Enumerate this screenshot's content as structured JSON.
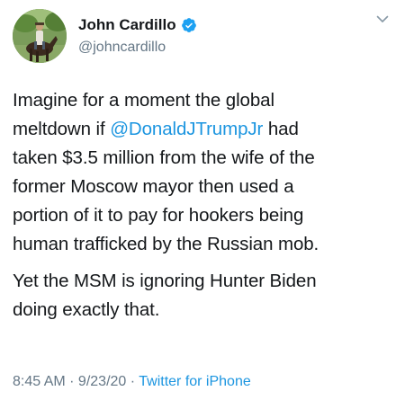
{
  "author": {
    "display_name": "John Cardillo",
    "handle": "@johncardillo",
    "verified": true,
    "avatar_icon": "avatar-photo",
    "verified_icon": "verified-badge-icon",
    "caret_icon": "chevron-down-icon"
  },
  "tweet": {
    "para1": {
      "line1": "Imagine for a moment the global",
      "line2_before": "meltdown if ",
      "line2_mention": "@DonaldJTrumpJr",
      "line2_after": " had",
      "line3": "taken $3.5 million from the wife of the",
      "line4": "former Moscow mayor then used a",
      "line5": "portion of it to pay for hookers being",
      "line6": "human trafficked by the Russian mob."
    },
    "para2": {
      "line1": "Yet the MSM is ignoring Hunter Biden",
      "line2": "doing exactly that."
    }
  },
  "meta": {
    "time": "8:45 AM",
    "sep1": " · ",
    "date": "9/23/20",
    "sep2": " · ",
    "source": "Twitter for iPhone"
  },
  "colors": {
    "text": "#14171a",
    "secondary": "#657786",
    "link": "#1b95e0",
    "verified": "#1da1f2"
  }
}
